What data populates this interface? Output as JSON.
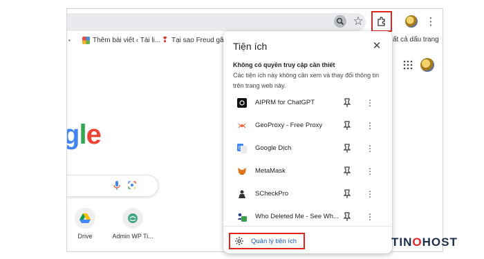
{
  "bookmarks": {
    "items": [
      {
        "label": "Thêm bài viết ‹ Tài li..."
      },
      {
        "label": "Tại sao Freud gây"
      }
    ],
    "overflow_label": "ất cả dấu trang"
  },
  "page": {
    "logo_text": "gle",
    "shortcuts": [
      {
        "label": "Drive",
        "icon": "drive-icon"
      },
      {
        "label": "Admin WP Ti...",
        "icon": "wordpress-icon"
      }
    ]
  },
  "extensions_popup": {
    "title": "Tiện ích",
    "section_title": "Không có quyền truy cập cần thiết",
    "section_desc": "Các tiện ích này không cần xem và thay đổi thông tin trên trang web này.",
    "items": [
      {
        "name": "AIPRM for ChatGPT",
        "icon": "aiprm-icon"
      },
      {
        "name": "GeoProxy - Free Proxy",
        "icon": "geoproxy-icon"
      },
      {
        "name": "Google Dịch",
        "icon": "google-translate-icon"
      },
      {
        "name": "MetaMask",
        "icon": "metamask-icon"
      },
      {
        "name": "SCheckPro",
        "icon": "scheckpro-icon"
      },
      {
        "name": "Who Deleted Me - See Wh...",
        "icon": "who-deleted-me-icon"
      }
    ],
    "manage_label": "Quản lý tiện ích"
  },
  "watermark": {
    "part1": "TIN",
    "part2": "O",
    "part3": "HOST"
  },
  "colors": {
    "highlight_border": "#e2231a",
    "link": "#1a57c4"
  }
}
